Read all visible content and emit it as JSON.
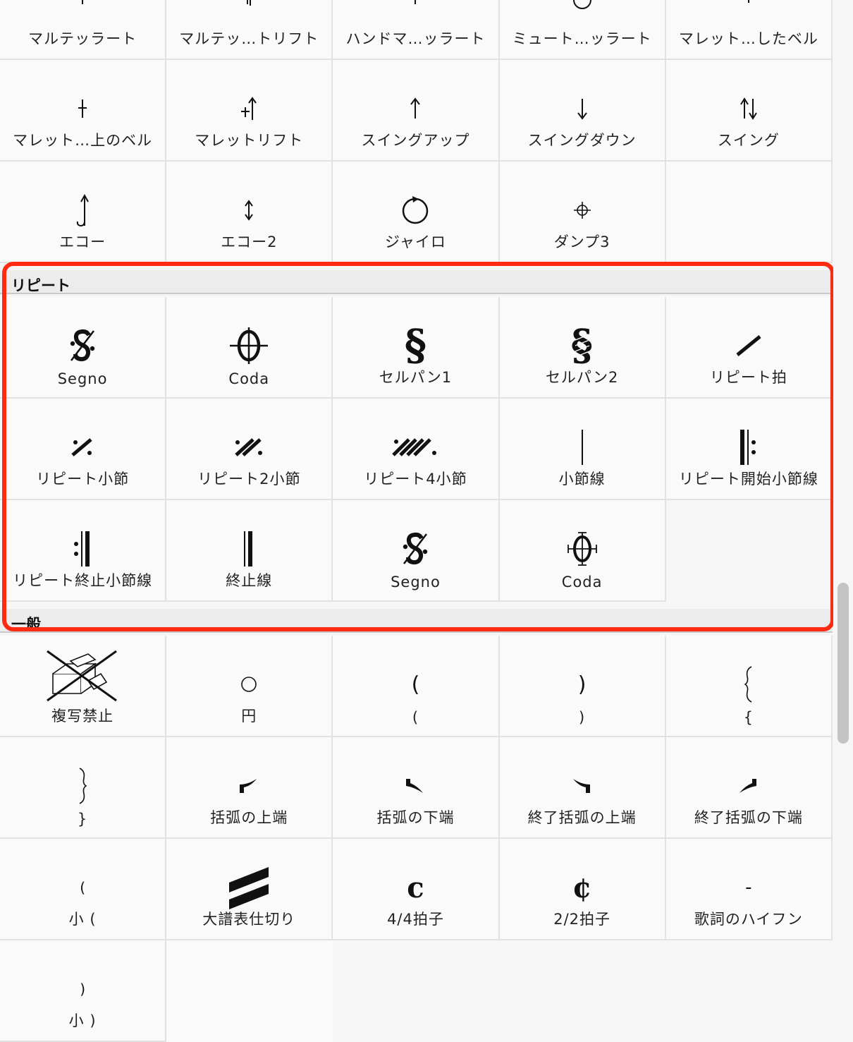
{
  "sections": {
    "repeat": "リピート",
    "general": "一般"
  },
  "rows": {
    "row0": [
      "マルテッラート",
      "マルテッ…トリフト",
      "ハンドマ…ッラート",
      "ミュート…ッラート",
      "マレット…したベル"
    ],
    "row1": [
      "マレット…上のベル",
      "マレットリフト",
      "スイングアップ",
      "スイングダウン",
      "スイング"
    ],
    "row2": [
      "エコー",
      "エコー2",
      "ジャイロ",
      "ダンプ3"
    ],
    "repeat1": [
      "Segno",
      "Coda",
      "セルパン1",
      "セルパン2",
      "リピート拍"
    ],
    "repeat2": [
      "リピート小節",
      "リピート2小節",
      "リピート4小節",
      "小節線",
      "リピート開始小節線"
    ],
    "repeat3": [
      "リピート終止小節線",
      "終止線",
      "Segno",
      "Coda"
    ],
    "general1": [
      "複写禁止",
      "円",
      "(",
      ")",
      "{"
    ],
    "general2": [
      "}",
      "括弧の上端",
      "括弧の下端",
      "終了括弧の上端",
      "終了括弧の下端"
    ],
    "general3": [
      "小 (",
      "大譜表仕切り",
      "4/4拍子",
      "2/2拍子",
      "歌詞のハイフン"
    ],
    "general4": [
      "小 )"
    ]
  },
  "glyphs": {
    "paren_open": "(",
    "paren_close": ")",
    "common_time": "c",
    "cut_time": "¢",
    "section_sign": "§",
    "hyphen": "-"
  },
  "colors": {
    "highlight": "#ff2a12",
    "cell_bg": "#fafafa",
    "grid_line": "#e2e2e2"
  }
}
